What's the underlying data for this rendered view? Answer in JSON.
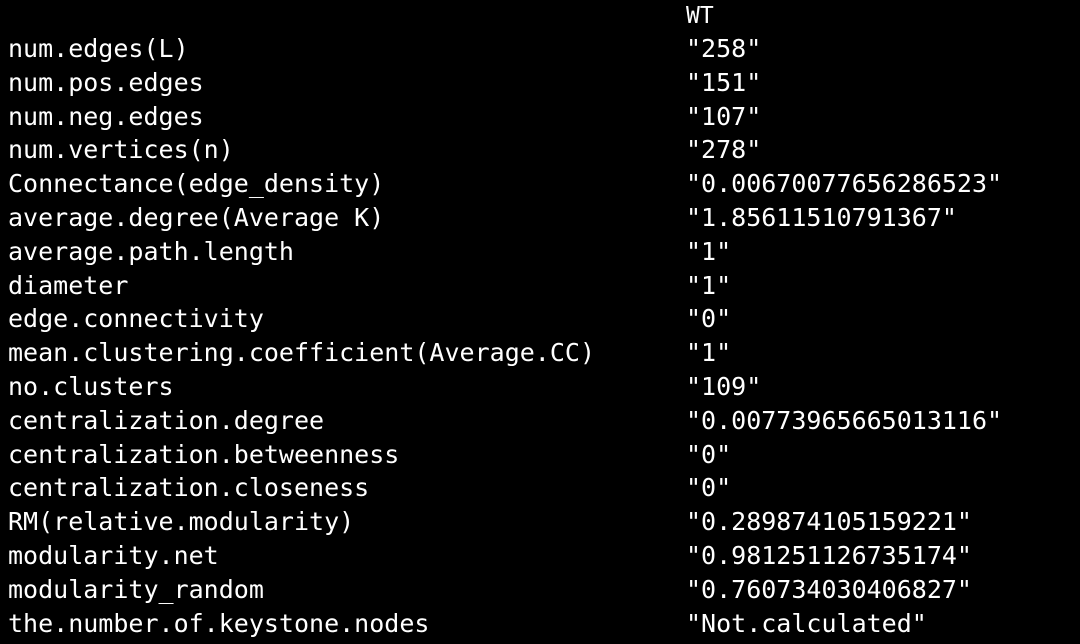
{
  "table": {
    "column_header": "WT",
    "rows": [
      {
        "name": "num.edges(L)",
        "value": "\"258\""
      },
      {
        "name": "num.pos.edges",
        "value": "\"151\""
      },
      {
        "name": "num.neg.edges",
        "value": "\"107\""
      },
      {
        "name": "num.vertices(n)",
        "value": "\"278\""
      },
      {
        "name": "Connectance(edge_density)",
        "value": "\"0.00670077656286523\""
      },
      {
        "name": "average.degree(Average K)",
        "value": "\"1.85611510791367\""
      },
      {
        "name": "average.path.length",
        "value": "\"1\""
      },
      {
        "name": "diameter",
        "value": "\"1\""
      },
      {
        "name": "edge.connectivity",
        "value": "\"0\""
      },
      {
        "name": "mean.clustering.coefficient(Average.CC)",
        "value": "\"1\""
      },
      {
        "name": "no.clusters",
        "value": "\"109\""
      },
      {
        "name": "centralization.degree",
        "value": "\"0.00773965665013116\""
      },
      {
        "name": "centralization.betweenness",
        "value": "\"0\""
      },
      {
        "name": "centralization.closeness",
        "value": "\"0\""
      },
      {
        "name": "RM(relative.modularity)",
        "value": "\"0.289874105159221\""
      },
      {
        "name": "modularity.net",
        "value": "\"0.981251126735174\""
      },
      {
        "name": "modularity_random",
        "value": "\"0.760734030406827\""
      },
      {
        "name": "the.number.of.keystone.nodes",
        "value": "\"Not.calculated\""
      }
    ]
  }
}
